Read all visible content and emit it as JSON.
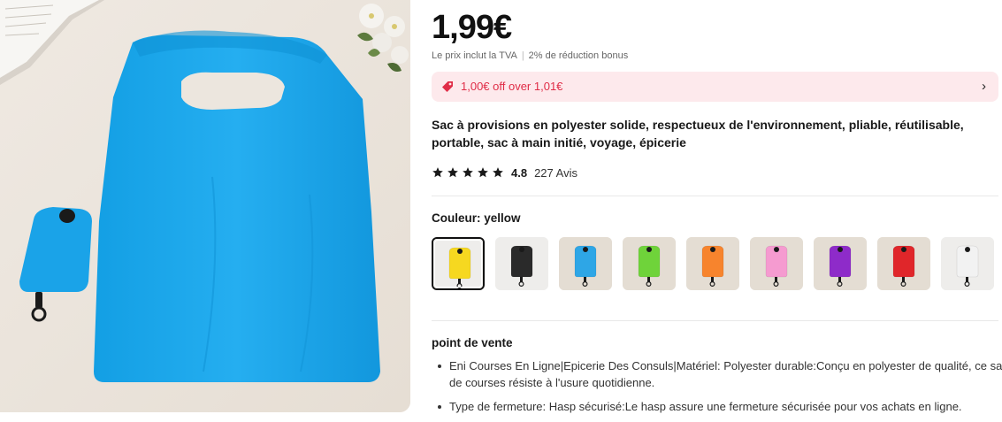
{
  "product": {
    "price": "1,99€",
    "price_note": "Le prix inclut la TVA",
    "bonus_note": "2% de réduction bonus",
    "promo_text": "1,00€ off over 1,01€",
    "title": "Sac à provisions en polyester solide, respectueux de l'environnement, pliable, réutilisable, portable, sac à main initié, voyage, épicerie",
    "rating_value": "4.8",
    "rating_stars": 5,
    "reviews_count": "227 Avis"
  },
  "variant": {
    "label": "Couleur: yellow",
    "swatches": [
      {
        "name": "yellow",
        "color": "#f6d820",
        "selected": true
      },
      {
        "name": "black",
        "color": "#2a2a2a",
        "selected": false
      },
      {
        "name": "blue",
        "color": "#2ea6e6",
        "selected": false
      },
      {
        "name": "green",
        "color": "#6fd33a",
        "selected": false
      },
      {
        "name": "orange",
        "color": "#f7842d",
        "selected": false
      },
      {
        "name": "pink",
        "color": "#f59bd0",
        "selected": false
      },
      {
        "name": "purple",
        "color": "#8e2bc9",
        "selected": false
      },
      {
        "name": "red",
        "color": "#e0262a",
        "selected": false
      },
      {
        "name": "white",
        "color": "#f2f2f2",
        "selected": false
      }
    ]
  },
  "details": {
    "section_title": "point de vente",
    "bullets": [
      "Eni Courses En Ligne|Epicerie Des Consuls|Matériel: Polyester durable:Conçu en polyester de qualité, ce sac de courses résiste à l'usure quotidienne.",
      "Type de fermeture: Hasp sécurisé:Le hasp assure une fermeture sécurisée pour vos achats en ligne."
    ]
  },
  "colors": {
    "promo_bg": "#fde9ec",
    "promo_text": "#e02d47",
    "bag_blue": "#1aa6ea"
  }
}
